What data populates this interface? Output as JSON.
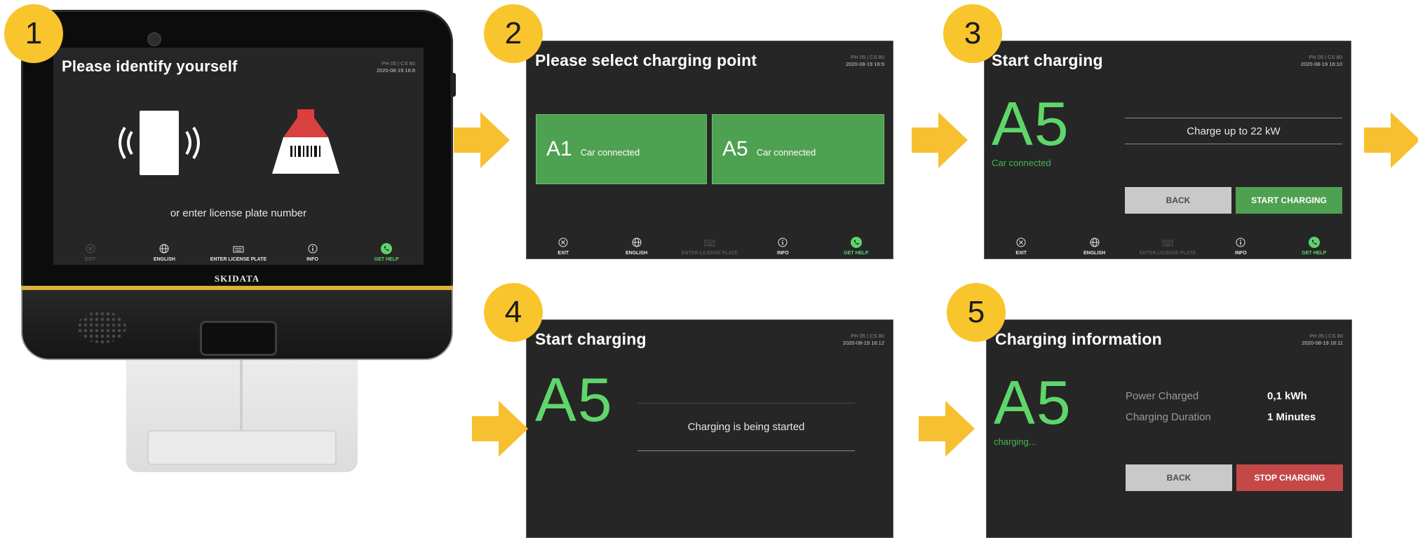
{
  "steps": [
    "1",
    "2",
    "3",
    "4",
    "5"
  ],
  "device": {
    "brand": "SKIDATA"
  },
  "screen1": {
    "title": "Please identify yourself",
    "meta_id": "PH 05 | CS 80",
    "meta_time": "2020-08-19 16:8",
    "prompt": "or enter license plate number"
  },
  "screen2": {
    "title": "Please select charging point",
    "meta_id": "PH 05 | CS 80",
    "meta_time": "2020-08-19 16:9",
    "tiles": [
      {
        "code": "A1",
        "status": "Car connected"
      },
      {
        "code": "A5",
        "status": "Car connected"
      }
    ]
  },
  "screen3": {
    "title": "Start charging",
    "meta_id": "PH 05 | CS 80",
    "meta_time": "2020-08-19 16:10",
    "code": "A5",
    "status": "Car connected",
    "charge_text": "Charge up to 22 kW",
    "back_label": "BACK",
    "start_label": "START CHARGING"
  },
  "screen4": {
    "title": "Start charging",
    "meta_id": "PH 05 | CS 80",
    "meta_time": "2020-08-19 16:12",
    "code": "A5",
    "message": "Charging is being started"
  },
  "screen5": {
    "title": "Charging information",
    "meta_id": "PH 05 | CS 80",
    "meta_time": "2020-08-19 16:11",
    "code": "A5",
    "status": "charging...",
    "power_label": "Power Charged",
    "power_value": "0,1 kWh",
    "duration_label": "Charging Duration",
    "duration_value": "1 Minutes",
    "back_label": "BACK",
    "stop_label": "STOP CHARGING"
  },
  "nav": {
    "exit": "EXIT",
    "english": "ENGLISH",
    "plate": "ENTER LICENSE PLATE",
    "info": "INFO",
    "help": "GET HELP"
  },
  "colors": {
    "badge": "#f8c52d",
    "arrow": "#f6c030",
    "screen_bg": "#262626",
    "accent_green": "#5fd66b",
    "tile_green": "#4ea151",
    "stop_red": "#c44848"
  },
  "icons": [
    "nfc-card-icon",
    "barcode-scanner-icon",
    "exit-icon",
    "globe-icon",
    "keyboard-icon",
    "info-icon",
    "phone-icon",
    "arrow-right-icon"
  ]
}
